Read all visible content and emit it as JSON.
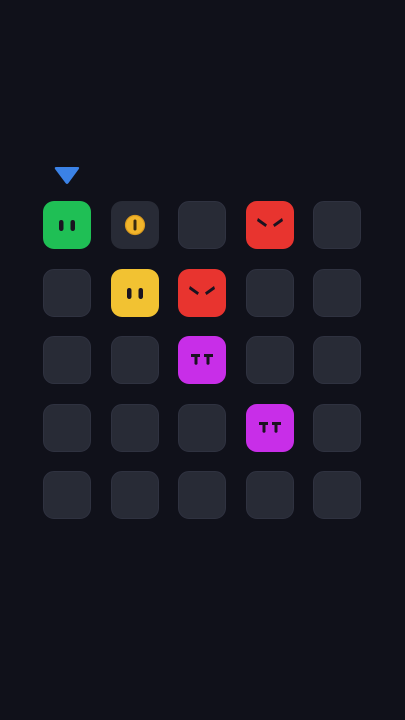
{
  "game": {
    "grid": {
      "rows": 5,
      "cols": 5
    },
    "drop_indicator": {
      "column": 0,
      "icon": "down-triangle-icon",
      "color": "#3b82e6"
    },
    "empty_tile_color": "#282b36",
    "pieces": [
      {
        "row": 0,
        "col": 0,
        "kind": "green-calm-blob",
        "icon": "green-blob-face-icon",
        "color": "#1fbf55"
      },
      {
        "row": 0,
        "col": 1,
        "kind": "coin",
        "icon": "coin-icon",
        "color": "#f2b52b"
      },
      {
        "row": 0,
        "col": 3,
        "kind": "red-angry-blob",
        "icon": "red-angry-face-icon",
        "color": "#e8342f"
      },
      {
        "row": 1,
        "col": 1,
        "kind": "yellow-calm-blob",
        "icon": "yellow-blob-face-icon",
        "color": "#f2c232"
      },
      {
        "row": 1,
        "col": 2,
        "kind": "red-angry-blob",
        "icon": "red-angry-face-icon",
        "color": "#e8342f"
      },
      {
        "row": 2,
        "col": 2,
        "kind": "purple-grumpy-blob",
        "icon": "purple-grumpy-face-icon",
        "color": "#c82ee8"
      },
      {
        "row": 3,
        "col": 3,
        "kind": "purple-grumpy-blob",
        "icon": "purple-grumpy-face-icon",
        "color": "#c82ee8"
      }
    ]
  }
}
